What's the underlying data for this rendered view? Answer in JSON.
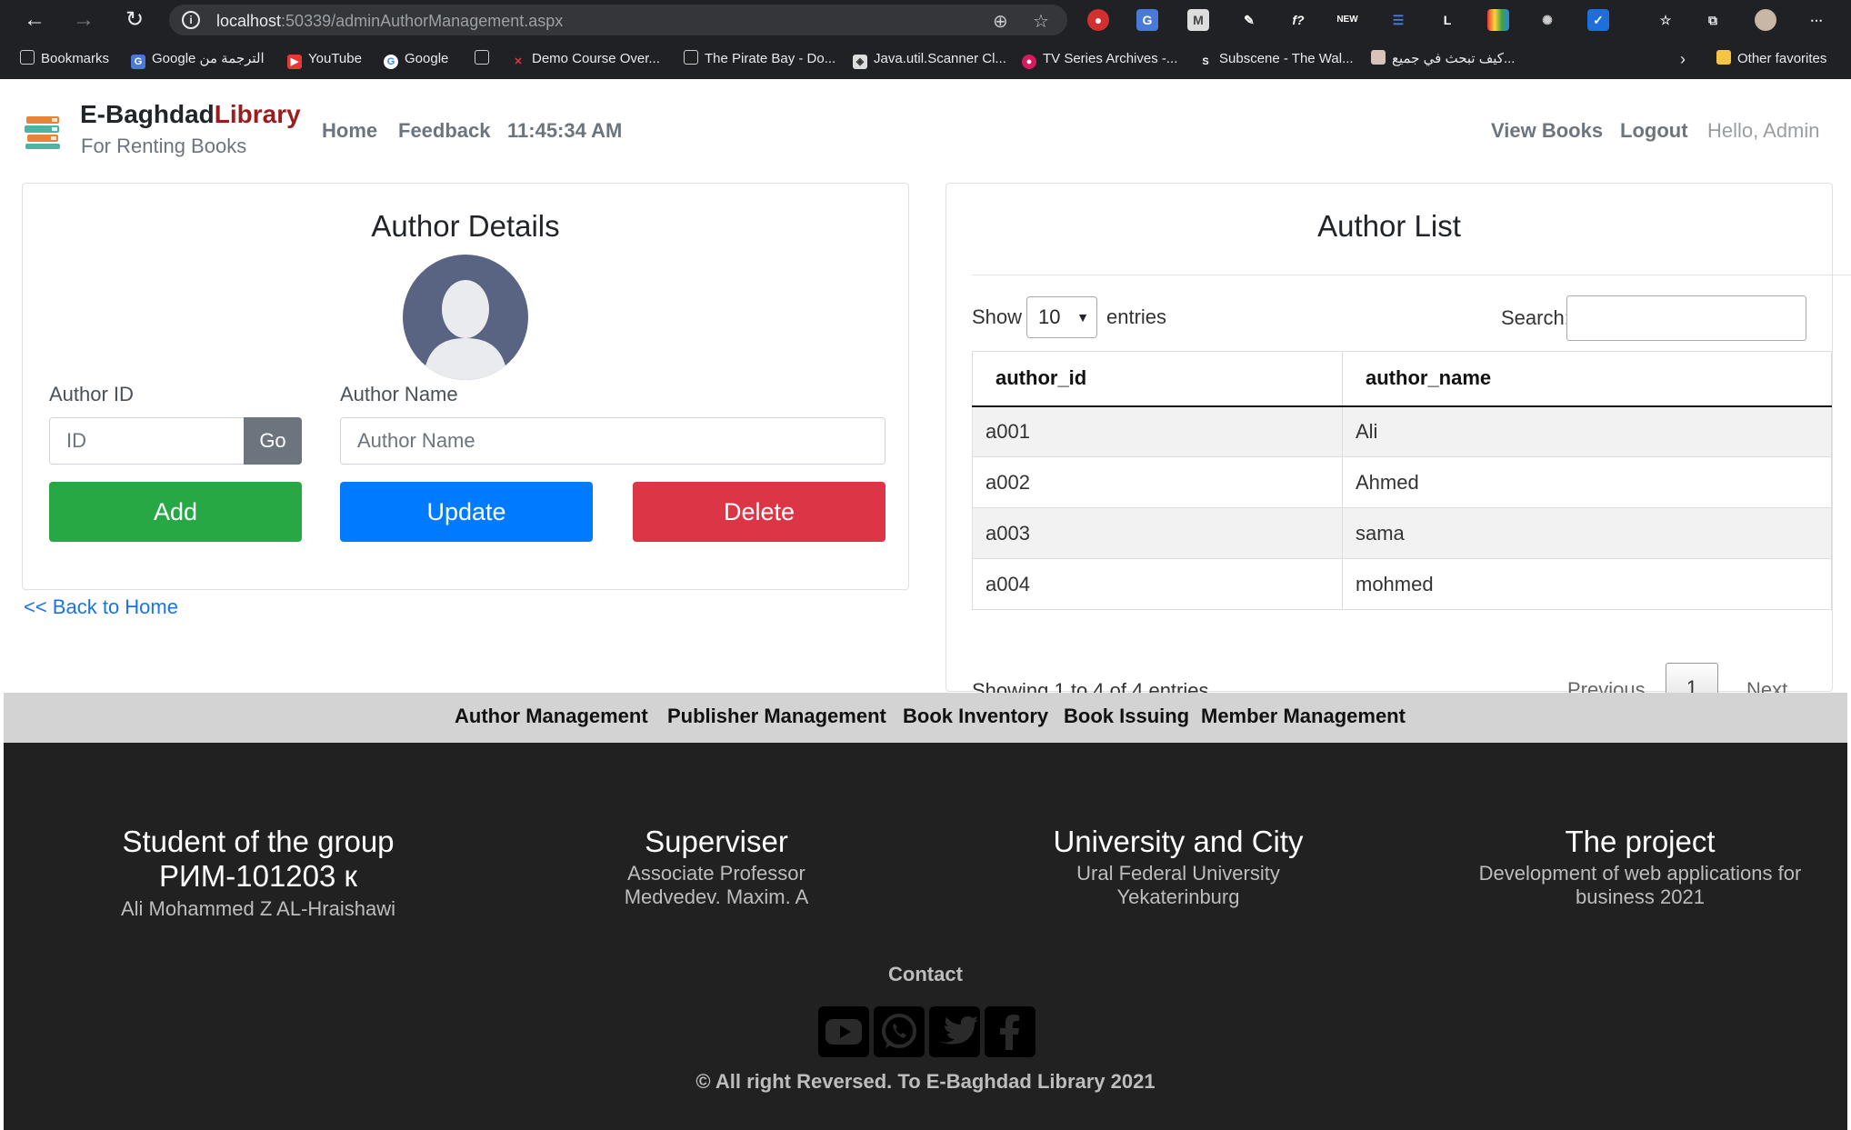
{
  "browser": {
    "url_host": "localhost",
    "url_path": ":50339/adminAuthorManagement.aspx",
    "bookmarks": [
      {
        "label": "Bookmarks",
        "icon": "page-icon"
      },
      {
        "label": "Google الترجمة من",
        "icon": "google-translate-icon"
      },
      {
        "label": "YouTube",
        "icon": "youtube-icon"
      },
      {
        "label": "Google",
        "icon": "google-icon"
      },
      {
        "label": "",
        "icon": "page-icon"
      },
      {
        "label": "Demo Course Over...",
        "icon": "course-icon"
      },
      {
        "label": "The Pirate Bay - Do...",
        "icon": "page-icon"
      },
      {
        "label": "Java.util.Scanner Cl...",
        "icon": "java-icon"
      },
      {
        "label": "TV Series Archives -...",
        "icon": "tv-icon"
      },
      {
        "label": "Subscene - The Wal...",
        "icon": "subscene-icon"
      },
      {
        "label": "كيف تبحث في جميع...",
        "icon": "avatar-icon"
      }
    ],
    "other_favorites": "Other favorites"
  },
  "site": {
    "brand_main": "E-Baghdad",
    "brand_accent": "Library",
    "brand_sub": "For Renting Books",
    "nav": {
      "home": "Home",
      "feedback": "Feedback",
      "clock": "11:45:34 AM",
      "view_books": "View Books",
      "logout": "Logout",
      "hello": "Hello, Admin"
    }
  },
  "details": {
    "title": "Author Details",
    "author_id_label": "Author ID",
    "author_id_placeholder": "ID",
    "go_label": "Go",
    "author_name_label": "Author Name",
    "author_name_placeholder": "Author Name",
    "add_label": "Add",
    "update_label": "Update",
    "delete_label": "Delete",
    "back_link": "<< Back to Home"
  },
  "list": {
    "title": "Author List",
    "show_label": "Show",
    "page_size": "10",
    "entries_label": "entries",
    "search_label": "Search:",
    "columns": [
      "author_id",
      "author_name"
    ],
    "rows": [
      [
        "a001",
        "Ali"
      ],
      [
        "a002",
        "Ahmed"
      ],
      [
        "a003",
        "sama"
      ],
      [
        "a004",
        "mohmed"
      ]
    ],
    "info": "Showing 1 to 4 of 4 entries",
    "previous": "Previous",
    "current_page": "1",
    "next": "Next"
  },
  "admin_nav": [
    "Author Management",
    "Publisher Management",
    "Book Inventory",
    "Book Issuing",
    "Member Management"
  ],
  "footer": {
    "col1": {
      "title_line1": "Student of the group",
      "title_line2": "РИМ-101203 к",
      "body": "Ali Mohammed Z AL-Hraishawi"
    },
    "col2": {
      "title": "Superviser",
      "body_line1": "Associate Professor",
      "body_line2": "Medvedev. Maxim. A"
    },
    "col3": {
      "title": "University and City",
      "body_line1": "Ural Federal University",
      "body_line2": "Yekaterinburg"
    },
    "col4": {
      "title": "The project",
      "body_line1": "Development of web applications for",
      "body_line2": "business 2021"
    },
    "contact": "Contact",
    "social_icons": [
      "youtube-icon",
      "whatsapp-icon",
      "twitter-icon",
      "facebook-icon"
    ],
    "copyright": "© All right Reversed. To E-Baghdad Library 2021"
  },
  "colors": {
    "add": "#28a745",
    "update": "#007bff",
    "delete": "#dc3545",
    "brand_accent": "#9b1c1c",
    "footer_bg": "#212121"
  }
}
